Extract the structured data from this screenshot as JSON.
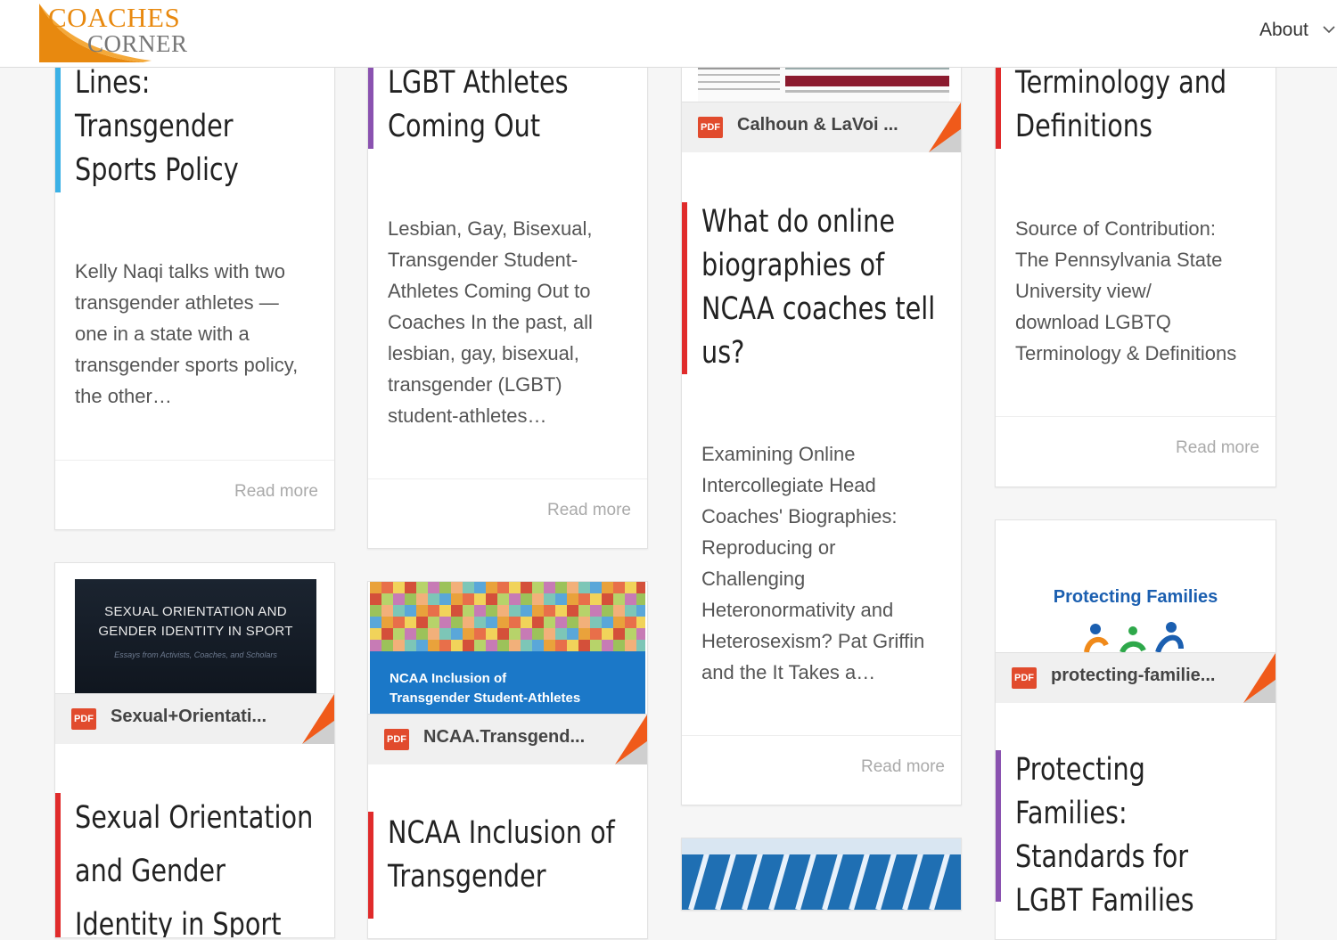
{
  "header": {
    "logo_line1": "COACHES",
    "logo_line2": "CORNER",
    "nav_about": "About"
  },
  "cards": {
    "c1": {
      "title_lines": [
        "Lines:",
        "Transgender",
        "Sports Policy"
      ],
      "excerpt_lines": [
        "Kelly Naqi talks with two",
        "transgender athletes —",
        "one in a state with a",
        "transgender sports policy,",
        "the other…"
      ],
      "read_more": "Read more",
      "bar_color": "#3bb1e6"
    },
    "c2": {
      "title_lines": [
        "LGBT Athletes",
        "Coming Out"
      ],
      "excerpt_lines": [
        "Lesbian, Gay, Bisexual,",
        "Transgender Student-",
        "Athletes Coming Out to",
        "Coaches In the past, all",
        "lesbian, gay, bisexual,",
        "transgender (LGBT)",
        "student-athletes…"
      ],
      "read_more": "Read more",
      "bar_color": "#8a52b0"
    },
    "c3": {
      "pdf_name": "Calhoun & LaVoi ...",
      "title_lines": [
        "What do online",
        "biographies of",
        "NCAA coaches tell",
        "us?"
      ],
      "excerpt_lines": [
        "Examining Online",
        "Intercollegiate Head",
        "Coaches' Biographies:",
        "Reproducing or",
        "Challenging",
        "Heteronormativity and",
        "Heterosexism? Pat Griffin",
        "and the It Takes a…"
      ],
      "read_more": "Read more",
      "bar_color": "#e02b2b"
    },
    "c4": {
      "title_lines": [
        "Terminology and",
        "Definitions"
      ],
      "excerpt_lines": [
        "Source of Contribution:",
        "The Pennsylvania State",
        "University view/",
        "download LGBTQ",
        "Terminology & Definitions"
      ],
      "read_more": "Read more",
      "bar_color": "#e02b2b"
    },
    "c5": {
      "thumb_line1": "SEXUAL ORIENTATION AND",
      "thumb_line2": "GENDER IDENTITY IN SPORT",
      "thumb_sub": "Essays from Activists, Coaches, and Scholars",
      "pdf_name": "Sexual+Orientati...",
      "title_lines": [
        "Sexual Orientation",
        "and Gender",
        "Identity in Sport"
      ],
      "bar_color": "#e02b2b"
    },
    "c6": {
      "thumb_line1": "NCAA Inclusion of",
      "thumb_line2": "Transgender Student-Athletes",
      "pdf_name": "NCAA.Transgend...",
      "title_lines": [
        "NCAA Inclusion of",
        "Transgender"
      ],
      "bar_color": "#e02b2b"
    },
    "c8": {
      "thumb_title": "Protecting Families",
      "pdf_name": "protecting-familie...",
      "title_lines": [
        "Protecting",
        "Families:",
        "Standards for",
        "LGBT Families"
      ],
      "bar_color": "#8a52b0"
    }
  },
  "colors": {
    "pdf_red": "#e14b2d",
    "corner_orange": "#f05a1a",
    "logo_orange": "#e8890f"
  }
}
